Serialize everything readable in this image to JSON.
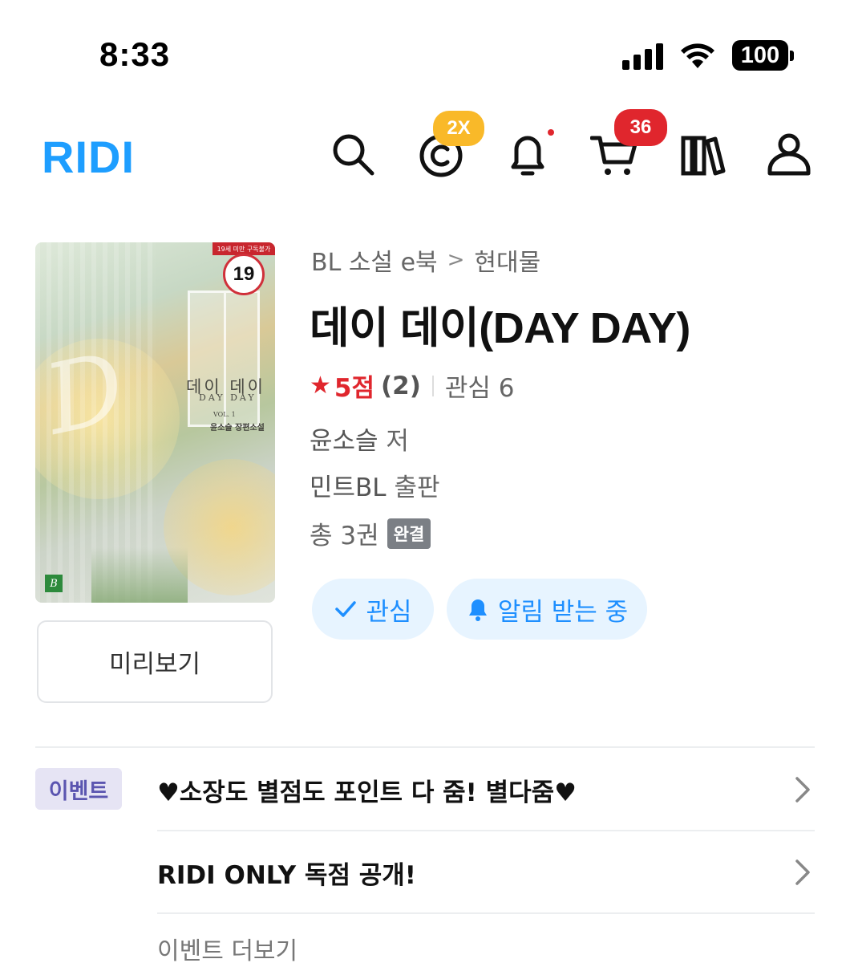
{
  "status_bar": {
    "time": "8:33",
    "battery": "100"
  },
  "header": {
    "logo": "RIDI",
    "icons": [
      "search-icon",
      "point-icon",
      "bell-icon",
      "cart-icon",
      "library-icon",
      "user-icon"
    ],
    "point_badge": "2X",
    "cart_badge": "36",
    "accent_color": "#1e9eff",
    "badge_red": "#e0262d",
    "badge_yellow": "#f9b929"
  },
  "cover": {
    "age_rating": "19",
    "ribbon": "19세 미만 구독불가",
    "title_ko": "데이 데이",
    "title_en": "DAY DAY",
    "volume": "VOL. 1",
    "author_line": "윤소슬 장편소설",
    "publisher_mark": "B"
  },
  "preview_label": "미리보기",
  "book": {
    "breadcrumb": [
      "BL 소설 e북",
      "현대물"
    ],
    "title": "데이 데이(DAY DAY)",
    "rating": "5점",
    "rating_count": "(2)",
    "wishlist": "관심 6",
    "author": "윤소슬",
    "author_suffix": "저",
    "publisher": "민트BL",
    "publisher_suffix": "출판",
    "total": "총 3권",
    "status": "완결"
  },
  "actions": {
    "wish_label": "관심",
    "alarm_label": "알림 받는 중"
  },
  "events": {
    "tag": "이벤트",
    "items": [
      "♥소장도 별점도 포인트 다 줌! 별다줌♥",
      "RIDI ONLY 독점 공개!"
    ],
    "more": "이벤트 더보기"
  }
}
